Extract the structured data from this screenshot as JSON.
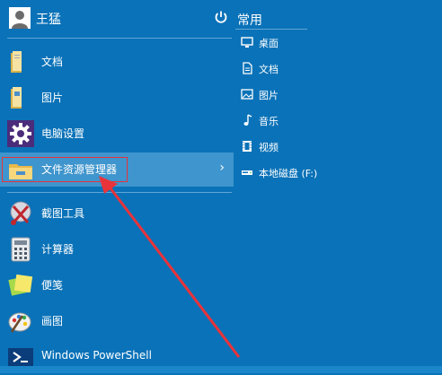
{
  "user": {
    "name": "王猛"
  },
  "header": {
    "label": "常用",
    "icon": "power-icon"
  },
  "left_items": [
    {
      "label": "文档",
      "icon": "folder-documents-icon"
    },
    {
      "label": "图片",
      "icon": "folder-pictures-icon"
    },
    {
      "label": "电脑设置",
      "icon": "settings-gear-icon"
    },
    {
      "label": "文件资源管理器",
      "icon": "file-explorer-icon",
      "highlighted": true,
      "chevron": "›"
    },
    {
      "label": "截图工具",
      "icon": "snipping-tool-icon"
    },
    {
      "label": "计算器",
      "icon": "calculator-icon"
    },
    {
      "label": "便笺",
      "icon": "sticky-notes-icon"
    },
    {
      "label": "画图",
      "icon": "paint-icon"
    },
    {
      "label": "Windows PowerShell",
      "icon": "powershell-icon"
    }
  ],
  "places": [
    {
      "label": "桌面",
      "icon": "desktop-icon"
    },
    {
      "label": "文档",
      "icon": "document-icon"
    },
    {
      "label": "图片",
      "icon": "picture-icon"
    },
    {
      "label": "音乐",
      "icon": "music-note-icon"
    },
    {
      "label": "视频",
      "icon": "video-film-icon"
    },
    {
      "label": "本地磁盘 (F:)",
      "icon": "local-disk-icon"
    }
  ],
  "colors": {
    "background": "#0a72b8",
    "highlight": "#3f95cd",
    "annotation": "#e8333a"
  }
}
